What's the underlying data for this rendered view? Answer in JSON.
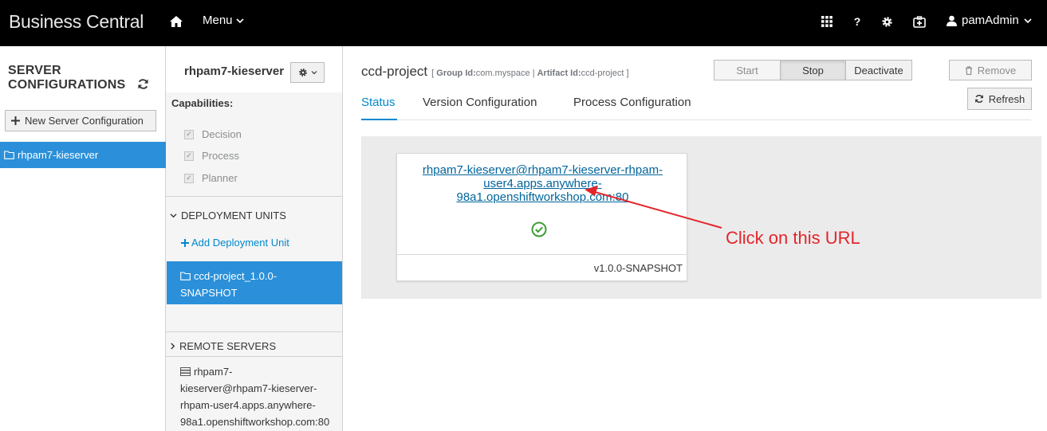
{
  "topbar": {
    "brand": "Business Central",
    "menu_label": "Menu",
    "help_label": "?",
    "user_label": "pamAdmin"
  },
  "sidebar": {
    "title_line1": "SERVER",
    "title_line2": "CONFIGURATIONS",
    "new_server_label": "New Server Configuration",
    "servers": [
      {
        "label": "rhpam7-kieserver"
      }
    ]
  },
  "server_panel": {
    "name": "rhpam7-kieserver",
    "capabilities_label": "Capabilities:",
    "capabilities": [
      {
        "label": "Decision",
        "checked": true
      },
      {
        "label": "Process",
        "checked": true
      },
      {
        "label": "Planner",
        "checked": true
      }
    ],
    "deployment_units_label": "DEPLOYMENT UNITS",
    "add_unit_label": "Add Deployment Unit",
    "units": [
      {
        "line1": "ccd-project_1.0.0-",
        "line2": "SNAPSHOT"
      }
    ],
    "remote_servers_label": "REMOTE SERVERS",
    "remote_servers": [
      {
        "lines": [
          "rhpam7-",
          "kieserver@rhpam7-kieserver-",
          "rhpam-user4.apps.anywhere-",
          "98a1.openshiftworkshop.com:80"
        ]
      }
    ]
  },
  "main": {
    "project_name": "ccd-project",
    "meta_open": "[",
    "group_id_label": "Group Id:",
    "group_id": "com.myspace",
    "meta_sep": "|",
    "artifact_id_label": "Artifact Id:",
    "artifact_id": "ccd-project",
    "meta_close": "]",
    "buttons": {
      "start": "Start",
      "stop": "Stop",
      "deactivate": "Deactivate",
      "remove": "Remove",
      "refresh": "Refresh"
    },
    "tabs": [
      {
        "label": "Status",
        "active": true
      },
      {
        "label": "Version Configuration",
        "active": false
      },
      {
        "label": "Process Configuration",
        "active": false
      }
    ],
    "card": {
      "url_lines": [
        "rhpam7-kieserver@rhpam7-kieserver-rhpam-",
        "user4.apps.anywhere-",
        "98a1.openshiftworkshop.com:80"
      ],
      "version": "v1.0.0-SNAPSHOT"
    }
  },
  "annotation": {
    "text": "Click on this URL",
    "color": "#e3252b"
  },
  "colors": {
    "accent": "#0088ce",
    "selected": "#2b90d9",
    "success": "#3f9c35",
    "topbar": "#000000"
  }
}
